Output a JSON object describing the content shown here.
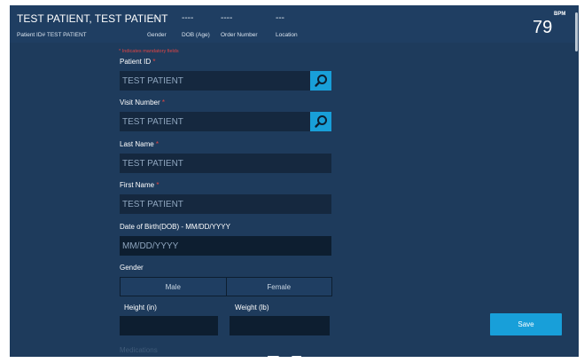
{
  "header": {
    "patient_name": "TEST PATIENT, TEST PATIENT",
    "patient_id": "Patient ID# TEST PATIENT",
    "gender_value": "----",
    "gender_label": "Gender",
    "dob_value": "----",
    "dob_label": "DOB (Age)",
    "order_value": "----",
    "order_label": "Order Number",
    "location_value": "---",
    "location_label": "Location",
    "bpm_label": "BPM",
    "bpm_value": "79"
  },
  "form": {
    "required_note": "* Indicates mandatory fields",
    "patient_id": {
      "label": "Patient ID",
      "required": "*",
      "value": "TEST PATIENT"
    },
    "visit_number": {
      "label": "Visit Number",
      "required": "*",
      "value": "TEST PATIENT"
    },
    "last_name": {
      "label": "Last Name",
      "required": "*",
      "value": "TEST PATIENT"
    },
    "first_name": {
      "label": "First Name",
      "required": "*",
      "value": "TEST PATIENT"
    },
    "dob": {
      "label": "Date of Birth(DOB) - MM/DD/YYYY",
      "placeholder": "MM/DD/YYYY"
    },
    "gender": {
      "label": "Gender",
      "options": [
        "Male",
        "Female"
      ]
    },
    "height": {
      "label": "Height (in)"
    },
    "weight": {
      "label": "Weight (lb)"
    },
    "medications": {
      "label": "Medications"
    }
  },
  "actions": {
    "save_label": "Save"
  },
  "colors": {
    "background": "#1e3b5c",
    "field": "#15283f",
    "accent": "#189fd9",
    "required": "#e04545"
  }
}
